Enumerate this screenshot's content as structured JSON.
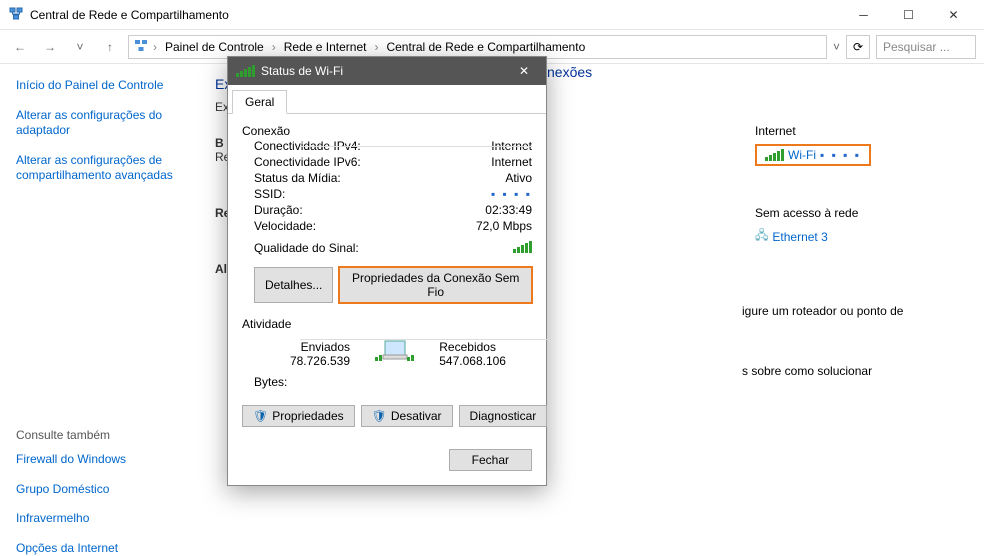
{
  "window": {
    "title": "Central de Rede e Compartilhamento"
  },
  "breadcrumb": {
    "items": [
      "Painel de Controle",
      "Rede e Internet",
      "Central de Rede e Compartilhamento"
    ]
  },
  "search": {
    "placeholder": "Pesquisar ..."
  },
  "sidebar": {
    "home": "Início do Painel de Controle",
    "links": [
      "Alterar as configurações do adaptador",
      "Alterar as configurações de compartilhamento avançadas"
    ],
    "seealso_label": "Consulte também",
    "seealso": [
      "Firewall do Windows",
      "Grupo Doméstico",
      "Infravermelho",
      "Opções da Internet"
    ]
  },
  "content": {
    "heading_partial_left": "Exibi",
    "heading_partial_right": "nexões",
    "sub": "Exibir r",
    "basic_label": "B",
    "basic_sub": "Re",
    "rede_label": "Re",
    "alterar_label": "Altera",
    "router_text": "igure um roteador ou ponto de",
    "troubleshoot_text": "s sobre como solucionar"
  },
  "network": {
    "internet_label": "Internet",
    "wifi": "Wi-Fi",
    "noaccess": "Sem acesso à rede",
    "ethernet": "Ethernet 3"
  },
  "dialog": {
    "title": "Status de Wi-Fi",
    "tab": "Geral",
    "group_conn": "Conexão",
    "rows": {
      "ipv4_k": "Conectividade IPv4:",
      "ipv4_v": "Internet",
      "ipv6_k": "Conectividade IPv6:",
      "ipv6_v": "Internet",
      "media_k": "Status da Mídia:",
      "media_v": "Ativo",
      "ssid_k": "SSID:",
      "ssid_v": "▪ ▪ ▪ ▪",
      "dur_k": "Duração:",
      "dur_v": "02:33:49",
      "speed_k": "Velocidade:",
      "speed_v": "72,0 Mbps",
      "signal_k": "Qualidade do Sinal:"
    },
    "btn_details": "Detalhes...",
    "btn_wireless": "Propriedades da Conexão Sem Fio",
    "group_activity": "Atividade",
    "sent_label": "Enviados",
    "recv_label": "Recebidos",
    "sent_val": "78.726.539",
    "recv_val": "547.068.106",
    "bytes_label": "Bytes:",
    "btn_props": "Propriedades",
    "btn_disable": "Desativar",
    "btn_diag": "Diagnosticar",
    "btn_close": "Fechar"
  }
}
